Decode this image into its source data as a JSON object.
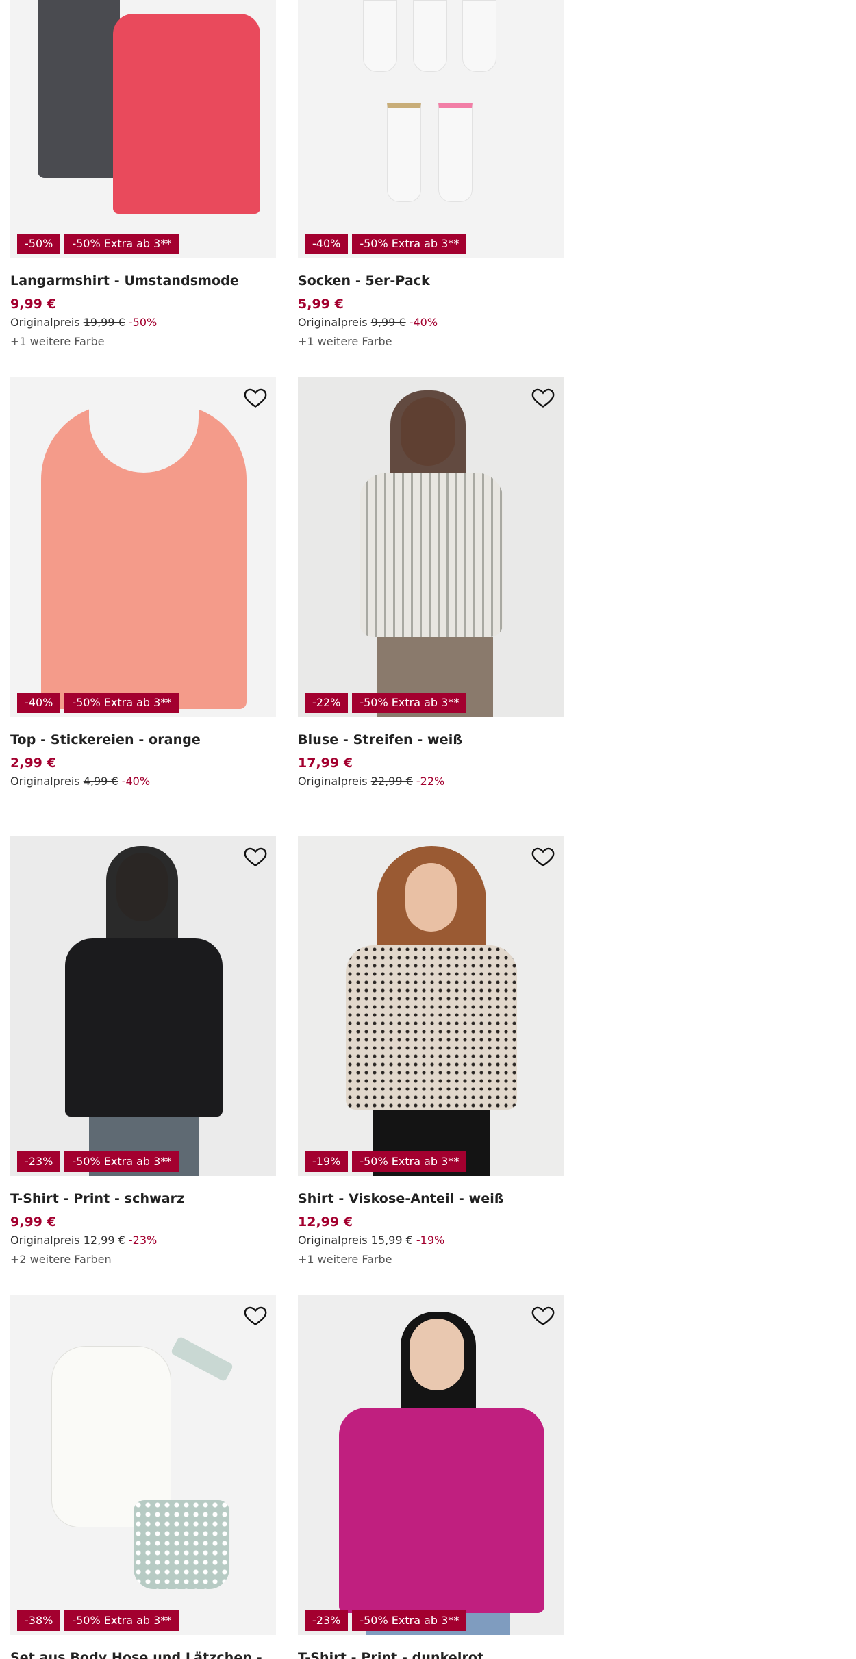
{
  "colors": {
    "accent": "#a3002f",
    "image_bg": "#f3f3f3"
  },
  "heart_icon": "heart-outline-icon",
  "products": [
    {
      "name": "Langarmshirt - Umstandsmode",
      "price": "9,99 €",
      "original_label": "Originalpreis",
      "original_price": "19,99 €",
      "discount": "-50%",
      "badge_discount": "-50%",
      "badge_extra": "-50% Extra ab 3**",
      "more_colors": "+1 weitere Farbe",
      "image": "two long-sleeve shirts, dark grey and pink"
    },
    {
      "name": "Socken - 5er-Pack",
      "price": "5,99 €",
      "original_label": "Originalpreis",
      "original_price": "9,99 €",
      "discount": "-40%",
      "badge_discount": "-40%",
      "badge_extra": "-50% Extra ab 3**",
      "more_colors": "+1 weitere Farbe",
      "image": "white socks with striped cuffs"
    },
    {
      "name": "Top - Stickereien - orange",
      "price": "2,99 €",
      "original_label": "Originalpreis",
      "original_price": "4,99 €",
      "discount": "-40%",
      "badge_discount": "-40%",
      "badge_extra": "-50% Extra ab 3**",
      "more_colors": "",
      "image": "orange ribbed tank top"
    },
    {
      "name": "Bluse - Streifen - weiß",
      "price": "17,99 €",
      "original_label": "Originalpreis",
      "original_price": "22,99 €",
      "discount": "-22%",
      "badge_discount": "-22%",
      "badge_extra": "-50% Extra ab 3**",
      "more_colors": "",
      "image": "woman in striped blouse"
    },
    {
      "name": "T-Shirt - Print - schwarz",
      "price": "9,99 €",
      "original_label": "Originalpreis",
      "original_price": "12,99 €",
      "discount": "-23%",
      "badge_discount": "-23%",
      "badge_extra": "-50% Extra ab 3**",
      "more_colors": "+2 weitere Farben",
      "image": "woman in black printed t-shirt"
    },
    {
      "name": "Shirt - Viskose-Anteil - weiß",
      "price": "12,99 €",
      "original_label": "Originalpreis",
      "original_price": "15,99 €",
      "discount": "-19%",
      "badge_discount": "-19%",
      "badge_extra": "-50% Extra ab 3**",
      "more_colors": "+1 weitere Farbe",
      "image": "woman in patterned blouse"
    },
    {
      "name": "Set aus Body Hose und Lätzchen - Disney Minnie Maus",
      "price": "",
      "original_label": "",
      "original_price": "",
      "discount": "",
      "badge_discount": "-38%",
      "badge_extra": "-50% Extra ab 3**",
      "more_colors": "",
      "image": "baby bodysuit with shorts and headband"
    },
    {
      "name": "T-Shirt - Print - dunkelrot",
      "price": "",
      "original_label": "",
      "original_price": "",
      "discount": "",
      "badge_discount": "-23%",
      "badge_extra": "-50% Extra ab 3**",
      "more_colors": "",
      "image": "woman in magenta printed t-shirt"
    }
  ]
}
